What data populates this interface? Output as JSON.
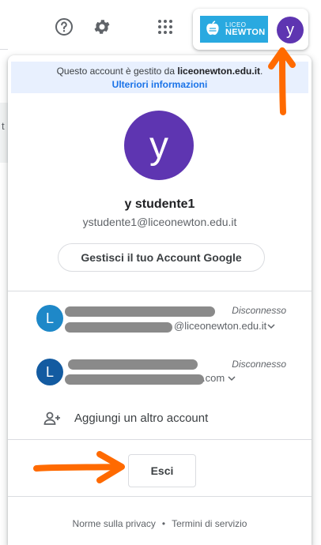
{
  "left_strip_char": "t",
  "header": {
    "icons": [
      "help-icon",
      "gear-icon",
      "apps-icon"
    ],
    "org_logo": {
      "top_text": "LICEO",
      "bottom_text": "NEWTON"
    },
    "avatar_letter": "y"
  },
  "panel": {
    "managed_notice_prefix": "Questo account è gestito da",
    "managed_domain": "liceonewton.edu.it",
    "managed_notice_suffix": ".",
    "learn_more": "Ulteriori informazioni",
    "avatar_letter": "y",
    "user_name": "y studente1",
    "user_email": "ystudente1@liceonewton.edu.it",
    "manage_account": "Gestisci il tuo Account Google",
    "accounts": [
      {
        "avatar_letter": "L",
        "status": "Disconnesso",
        "email_tail": "@liceonewton.edu.it"
      },
      {
        "avatar_letter": "L",
        "status": "Disconnesso",
        "email_tail": ".com"
      }
    ],
    "add_account": "Aggiungi un altro account",
    "sign_out": "Esci",
    "footer": {
      "privacy": "Norme sulla privacy",
      "separator": "•",
      "terms": "Termini di servizio"
    }
  },
  "colors": {
    "avatar": "#5e35b1",
    "link": "#1a73e8",
    "banner": "#e8f0fe",
    "annotation_arrow": "#ff6a00",
    "org_logo": "#29a9e0"
  }
}
